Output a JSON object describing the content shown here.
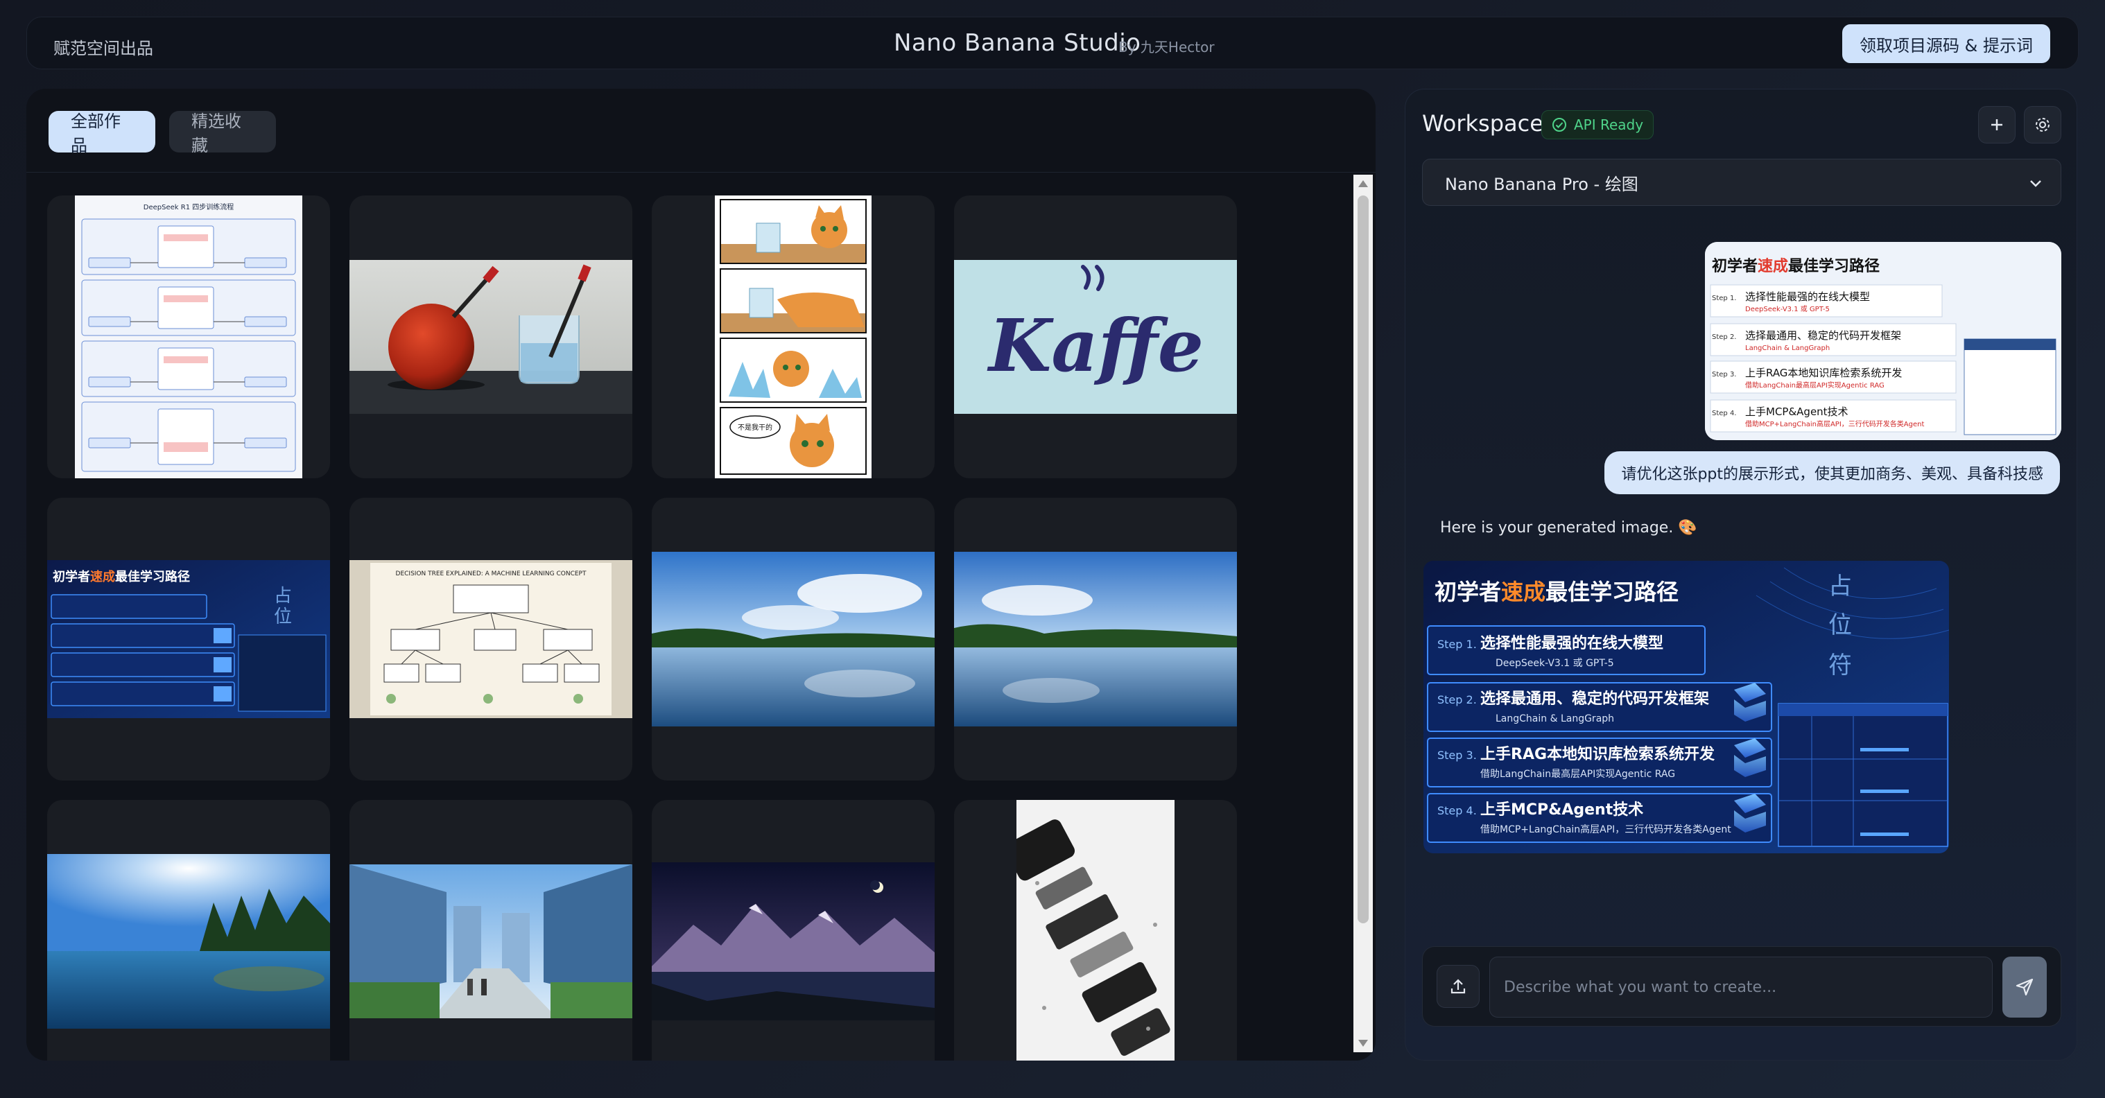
{
  "header": {
    "brand_left": "赋范空间出品",
    "title": "Nano Banana Studio",
    "by": "By 九天Hector",
    "cta_label": "领取项目源码 & 提示词"
  },
  "gallery": {
    "tabs": [
      {
        "label": "全部作品",
        "active": true
      },
      {
        "label": "精选收藏",
        "active": false
      }
    ],
    "items": [
      {
        "icon": "flowchart-thumbnail",
        "title": "DeepSeek R1 四步训练流程"
      },
      {
        "icon": "tomato-experiment-thumbnail"
      },
      {
        "icon": "cat-comic-thumbnail",
        "caption": "不是我干的"
      },
      {
        "icon": "kaffe-logo-thumbnail",
        "text": "Kaffe"
      },
      {
        "icon": "learning-path-slide-thumbnail",
        "title_pre": "初学者",
        "title_hl": "速成",
        "title_post": "最佳学习路径"
      },
      {
        "icon": "decision-tree-thumbnail",
        "title": "DECISION TREE EXPLAINED: A MACHINE LEARNING CONCEPT"
      },
      {
        "icon": "lake-landscape-thumbnail"
      },
      {
        "icon": "lake-landscape-thumbnail"
      },
      {
        "icon": "sunny-lake-thumbnail"
      },
      {
        "icon": "city-street-thumbnail"
      },
      {
        "icon": "mountain-night-thumbnail"
      },
      {
        "icon": "phone-exploded-thumbnail"
      }
    ]
  },
  "workspace": {
    "title": "Workspace",
    "api_status": "API Ready",
    "status_color": "#4fd48a",
    "model_selected": "Nano Banana Pro - 绘图",
    "user_message": "请优化这张ppt的展示形式，使其更加商务、美观、具备科技感",
    "ai_message": "Here is your generated image. 🎨",
    "prompt_placeholder": "Describe what you want to create...",
    "slide": {
      "title_pre": "初学者",
      "title_hl": "速成",
      "title_post": "最佳学习路径",
      "side_label": "占位符",
      "steps": [
        {
          "num": "Step 1.",
          "title": "选择性能最强的在线大模型",
          "sub": "DeepSeek-V3.1 或 GPT-5"
        },
        {
          "num": "Step 2.",
          "title": "选择最通用、稳定的代码开发框架",
          "sub": "LangChain & LangGraph"
        },
        {
          "num": "Step 3.",
          "title": "上手RAG本地知识库检索系统开发",
          "sub": "借助LangChain最高层API实现Agentic RAG"
        },
        {
          "num": "Step 4.",
          "title": "上手MCP&Agent技术",
          "sub": "借助MCP+LangChain高层API，三行代码开发各类Agent"
        }
      ]
    }
  }
}
